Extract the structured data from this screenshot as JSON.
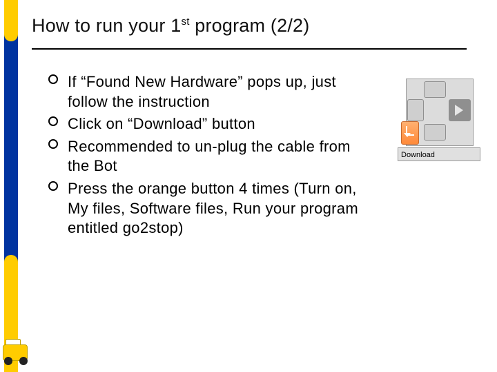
{
  "title_prefix": "How to run your 1",
  "title_ord": "st",
  "title_suffix": " program (2/2)",
  "bullets": [
    "If “Found New Hardware” pops up, just follow the instruction",
    "Click on “Download” button",
    "Recommended to un-plug the cable from the Bot",
    "Press the orange button 4 times (Turn on, My files, Software files, Run your program entitled go2stop)"
  ],
  "clip_label": "Download"
}
